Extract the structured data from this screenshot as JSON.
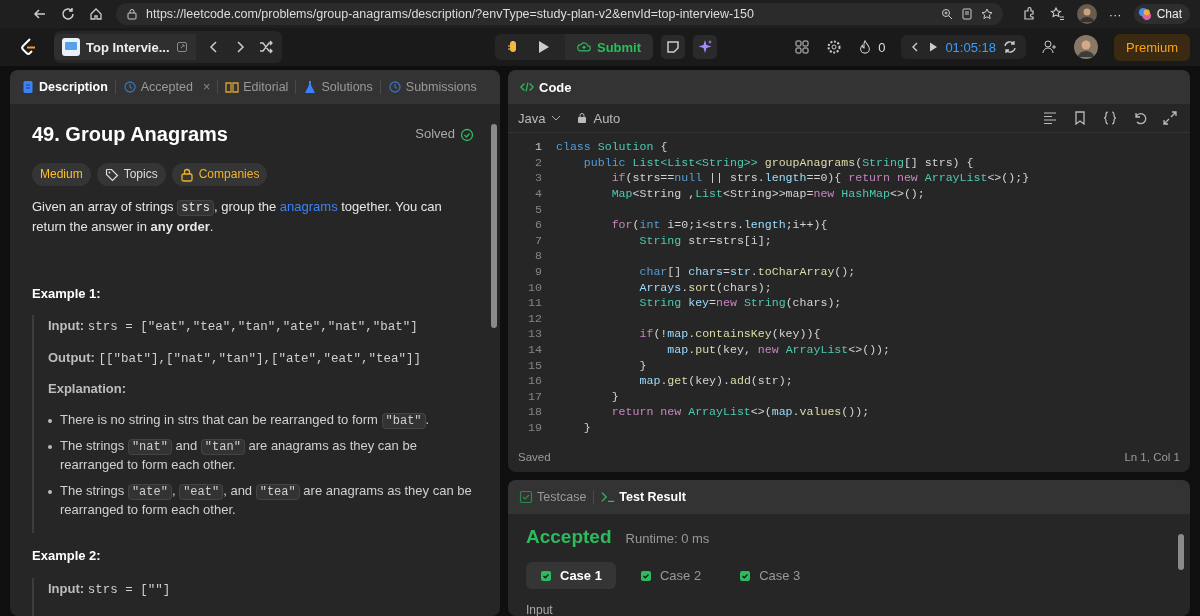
{
  "browser": {
    "url": "https://leetcode.com/problems/group-anagrams/description/?envType=study-plan-v2&envId=top-interview-150",
    "more": "···",
    "chat": "Chat"
  },
  "topbar": {
    "list_title": "Top Intervie...",
    "submit": "Submit",
    "streak": "0",
    "timer": "01:05:18",
    "premium": "Premium"
  },
  "left_tabs": [
    {
      "label": "Description",
      "kind": "description",
      "selected": true
    },
    {
      "label": "Accepted",
      "kind": "history",
      "selected": false,
      "close": "×"
    },
    {
      "label": "Editorial",
      "kind": "book",
      "selected": false
    },
    {
      "label": "Solutions",
      "kind": "flask",
      "selected": false
    },
    {
      "label": "Submissions",
      "kind": "history",
      "selected": false
    }
  ],
  "problem": {
    "title": "49. Group Anagrams",
    "status": "Solved",
    "difficulty": "Medium",
    "tags": [
      {
        "label": "Topics",
        "kind": "tag"
      },
      {
        "label": "Companies",
        "kind": "lock"
      }
    ],
    "description": [
      {
        "kind": "text",
        "text": "Given an array of strings "
      },
      {
        "kind": "code",
        "text": "strs"
      },
      {
        "kind": "text",
        "text": ", group the "
      },
      {
        "kind": "link",
        "text": "anagrams"
      },
      {
        "kind": "text",
        "text": " together. You can return the answer in "
      },
      {
        "kind": "bold",
        "text": "any order"
      },
      {
        "kind": "text",
        "text": "."
      }
    ],
    "examples": [
      {
        "title": "Example 1:",
        "input_label": "Input:",
        "input": "strs = [\"eat\",\"tea\",\"tan\",\"ate\",\"nat\",\"bat\"]",
        "output_label": "Output:",
        "output": "[[\"bat\"],[\"nat\",\"tan\"],[\"ate\",\"eat\",\"tea\"]]",
        "explanation_label": "Explanation:",
        "bullets": [
          [
            {
              "kind": "text",
              "text": "There is no string in strs that can be rearranged to form "
            },
            {
              "kind": "code",
              "text": "\"bat\""
            },
            {
              "kind": "text",
              "text": "."
            }
          ],
          [
            {
              "kind": "text",
              "text": "The strings "
            },
            {
              "kind": "code",
              "text": "\"nat\""
            },
            {
              "kind": "text",
              "text": " and "
            },
            {
              "kind": "code",
              "text": "\"tan\""
            },
            {
              "kind": "text",
              "text": " are anagrams as they can be rearranged to form each other."
            }
          ],
          [
            {
              "kind": "text",
              "text": "The strings "
            },
            {
              "kind": "code",
              "text": "\"ate\""
            },
            {
              "kind": "text",
              "text": ", "
            },
            {
              "kind": "code",
              "text": "\"eat\""
            },
            {
              "kind": "text",
              "text": ", and "
            },
            {
              "kind": "code",
              "text": "\"tea\""
            },
            {
              "kind": "text",
              "text": " are anagrams as they can be rearranged to form each other."
            }
          ]
        ]
      },
      {
        "title": "Example 2:",
        "input_label": "Input:",
        "input": "strs = [\"\"]"
      }
    ]
  },
  "code_panel": {
    "title": "Code",
    "language": "Java",
    "mode": "Auto",
    "status": "Saved",
    "cursor": "Ln 1, Col 1",
    "lines": [
      {
        "n": "1",
        "tokens": [
          {
            "kind": "kw",
            "text": "class "
          },
          {
            "kind": "type",
            "text": "Solution"
          },
          {
            "kind": "p",
            "text": " {"
          }
        ]
      },
      {
        "n": "2",
        "tokens": [
          {
            "kind": "kw",
            "text": "    public "
          },
          {
            "kind": "type",
            "text": "List<List<String>> "
          },
          {
            "kind": "fn",
            "text": "groupAnagrams"
          },
          {
            "kind": "p",
            "text": "("
          },
          {
            "kind": "type",
            "text": "String"
          },
          {
            "kind": "p",
            "text": "[] strs) {"
          }
        ]
      },
      {
        "n": "3",
        "tokens": [
          {
            "kind": "ctl",
            "text": "        if"
          },
          {
            "kind": "p",
            "text": "(strs=="
          },
          {
            "kind": "kw",
            "text": "null"
          },
          {
            "kind": "p",
            "text": " || strs."
          },
          {
            "kind": "var",
            "text": "length"
          },
          {
            "kind": "p",
            "text": "==0){ "
          },
          {
            "kind": "ctl",
            "text": "return new "
          },
          {
            "kind": "type",
            "text": "ArrayList"
          },
          {
            "kind": "p",
            "text": "<>();}"
          }
        ]
      },
      {
        "n": "4",
        "tokens": [
          {
            "kind": "type",
            "text": "        Map"
          },
          {
            "kind": "p",
            "text": "<String ,"
          },
          {
            "kind": "type",
            "text": "List"
          },
          {
            "kind": "p",
            "text": "<String>>map="
          },
          {
            "kind": "ctl",
            "text": "new "
          },
          {
            "kind": "type",
            "text": "HashMap"
          },
          {
            "kind": "p",
            "text": "<>();"
          }
        ]
      },
      {
        "n": "5"
      },
      {
        "n": "6",
        "tokens": [
          {
            "kind": "ctl",
            "text": "        for"
          },
          {
            "kind": "p",
            "text": "("
          },
          {
            "kind": "kw",
            "text": "int "
          },
          {
            "kind": "p",
            "text": "i=0;i<strs."
          },
          {
            "kind": "var",
            "text": "length"
          },
          {
            "kind": "p",
            "text": ";i++){"
          }
        ]
      },
      {
        "n": "7",
        "tokens": [
          {
            "kind": "type",
            "text": "            String "
          },
          {
            "kind": "p",
            "text": "str=strs[i];"
          }
        ]
      },
      {
        "n": "8"
      },
      {
        "n": "9",
        "tokens": [
          {
            "kind": "kw",
            "text": "            char"
          },
          {
            "kind": "p",
            "text": "[] "
          },
          {
            "kind": "var",
            "text": "chars"
          },
          {
            "kind": "p",
            "text": "="
          },
          {
            "kind": "var",
            "text": "str"
          },
          {
            "kind": "p",
            "text": "."
          },
          {
            "kind": "fn",
            "text": "toCharArray"
          },
          {
            "kind": "p",
            "text": "();"
          }
        ]
      },
      {
        "n": "10",
        "tokens": [
          {
            "kind": "var",
            "text": "            Arrays"
          },
          {
            "kind": "p",
            "text": "."
          },
          {
            "kind": "fn",
            "text": "sort"
          },
          {
            "kind": "p",
            "text": "(chars);"
          }
        ]
      },
      {
        "n": "11",
        "tokens": [
          {
            "kind": "type",
            "text": "            String "
          },
          {
            "kind": "var",
            "text": "key"
          },
          {
            "kind": "p",
            "text": "="
          },
          {
            "kind": "ctl",
            "text": "new "
          },
          {
            "kind": "type",
            "text": "String"
          },
          {
            "kind": "p",
            "text": "(chars);"
          }
        ]
      },
      {
        "n": "12"
      },
      {
        "n": "13",
        "tokens": [
          {
            "kind": "ctl",
            "text": "            if"
          },
          {
            "kind": "p",
            "text": "(!"
          },
          {
            "kind": "var",
            "text": "map"
          },
          {
            "kind": "p",
            "text": "."
          },
          {
            "kind": "fn",
            "text": "containsKey"
          },
          {
            "kind": "p",
            "text": "(key)){"
          }
        ]
      },
      {
        "n": "14",
        "tokens": [
          {
            "kind": "var",
            "text": "                map"
          },
          {
            "kind": "p",
            "text": "."
          },
          {
            "kind": "fn",
            "text": "put"
          },
          {
            "kind": "p",
            "text": "(key, "
          },
          {
            "kind": "ctl",
            "text": "new "
          },
          {
            "kind": "type",
            "text": "ArrayList"
          },
          {
            "kind": "p",
            "text": "<>());"
          }
        ]
      },
      {
        "n": "15",
        "tokens": [
          {
            "kind": "p",
            "text": "            }"
          }
        ]
      },
      {
        "n": "16",
        "tokens": [
          {
            "kind": "var",
            "text": "            map"
          },
          {
            "kind": "p",
            "text": "."
          },
          {
            "kind": "fn",
            "text": "get"
          },
          {
            "kind": "p",
            "text": "(key)."
          },
          {
            "kind": "fn",
            "text": "add"
          },
          {
            "kind": "p",
            "text": "(str);"
          }
        ]
      },
      {
        "n": "17",
        "tokens": [
          {
            "kind": "p",
            "text": "        }"
          }
        ]
      },
      {
        "n": "18",
        "tokens": [
          {
            "kind": "ctl",
            "text": "        return new "
          },
          {
            "kind": "type",
            "text": "ArrayList"
          },
          {
            "kind": "p",
            "text": "<>("
          },
          {
            "kind": "var",
            "text": "map"
          },
          {
            "kind": "p",
            "text": "."
          },
          {
            "kind": "fn",
            "text": "values"
          },
          {
            "kind": "p",
            "text": "());"
          }
        ]
      },
      {
        "n": "19",
        "tokens": [
          {
            "kind": "p",
            "text": "    }"
          }
        ]
      }
    ]
  },
  "test_tabs": [
    {
      "label": "Testcase",
      "kind": "check",
      "selected": false
    },
    {
      "label": "Test Result",
      "kind": "terminal",
      "selected": true
    }
  ],
  "result": {
    "verdict": "Accepted",
    "runtime": "Runtime: 0 ms",
    "cases": [
      {
        "label": "Case 1",
        "passed": true,
        "selected": true
      },
      {
        "label": "Case 2",
        "passed": true,
        "selected": false
      },
      {
        "label": "Case 3",
        "passed": true,
        "selected": false
      }
    ],
    "input_label": "Input"
  }
}
